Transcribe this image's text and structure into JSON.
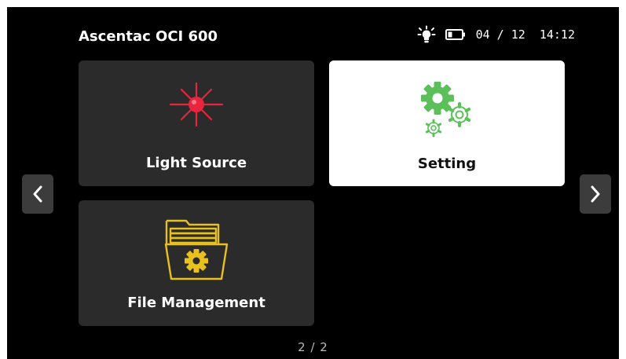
{
  "header": {
    "title": "Ascentac OCI 600",
    "date": "04 / 12",
    "time": "14:12",
    "status_icons": [
      "light-bulb-icon",
      "battery-icon"
    ]
  },
  "tiles": [
    {
      "label": "Light Source",
      "icon": "laser-icon",
      "selected": false
    },
    {
      "label": "Setting",
      "icon": "gears-icon",
      "selected": true
    },
    {
      "label": "File Management",
      "icon": "folder-gear-icon",
      "selected": false
    }
  ],
  "navigation": {
    "prev_icon": "chevron-left-icon",
    "next_icon": "chevron-right-icon"
  },
  "pagination": {
    "text": "2 / 2"
  },
  "colors": {
    "background": "#000000",
    "tile": "#2b2b2b",
    "tile_selected": "#ffffff",
    "laser_red": "#e8253c",
    "gear_green": "#5cc05a",
    "folder_yellow": "#e8c020",
    "nav_button": "#3c3c3c"
  }
}
